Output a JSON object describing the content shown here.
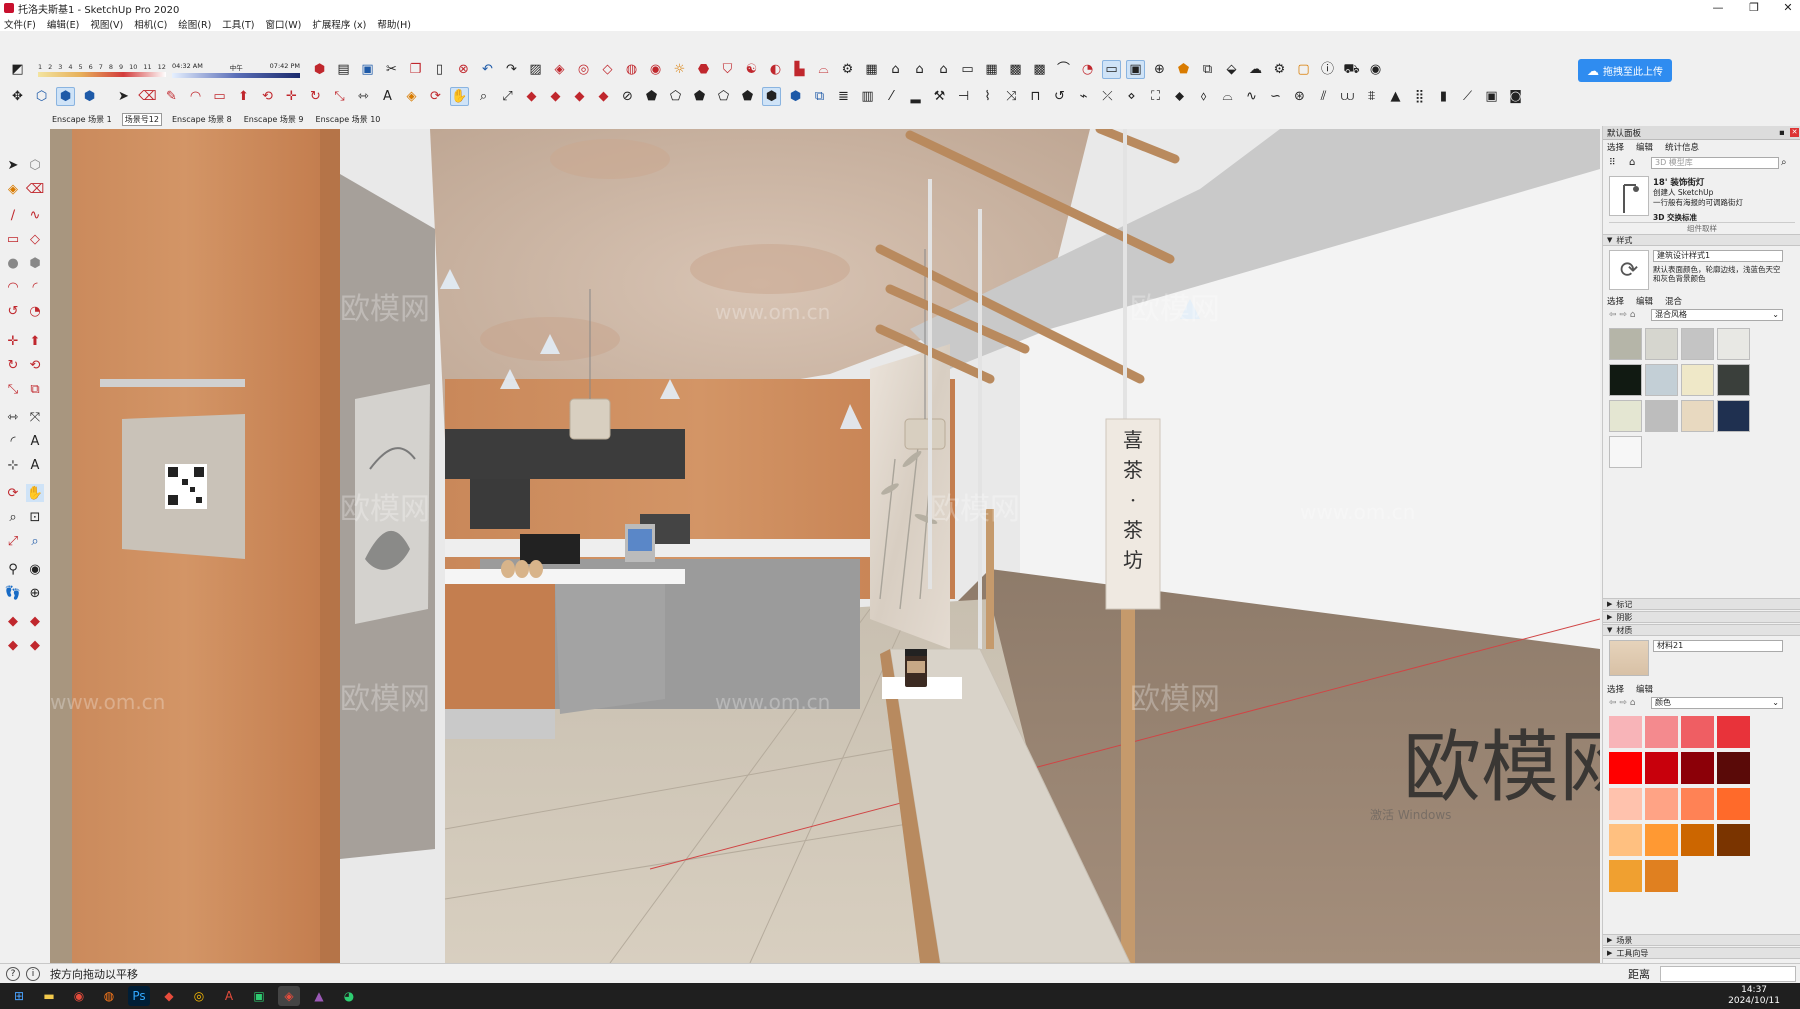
{
  "window": {
    "title": "托洛夫斯基1 - SketchUp Pro 2020",
    "minimize": "—",
    "restore": "❐",
    "close": "✕"
  },
  "menu": [
    "文件(F)",
    "编辑(E)",
    "视图(V)",
    "相机(C)",
    "绘图(R)",
    "工具(T)",
    "窗口(W)",
    "扩展程序 (x)",
    "帮助(H)"
  ],
  "shadow_settings": {
    "months": [
      "1",
      "2",
      "3",
      "4",
      "5",
      "6",
      "7",
      "8",
      "9",
      "10",
      "11",
      "12"
    ],
    "time_start": "04:32 AM",
    "time_mid": "中午",
    "time_end": "07:42 PM"
  },
  "upload_button": "拖拽至此上传",
  "scene_tabs": [
    {
      "label": "Enscape 场景 1",
      "active": false
    },
    {
      "label": "场景号12",
      "active": true
    },
    {
      "label": "Enscape 场景 8",
      "active": false
    },
    {
      "label": "Enscape 场景 9",
      "active": false
    },
    {
      "label": "Enscape 场景 10",
      "active": false
    }
  ],
  "viewport": {
    "sign_text": [
      "喜",
      "茶",
      "·",
      "茶",
      "坊"
    ],
    "watermarks": [
      "欧模网",
      "www.om.cn"
    ],
    "big_watermark": "欧模网",
    "ghost_text": "激活 Windows"
  },
  "panel": {
    "title": "默认面板",
    "components": {
      "tabs": [
        "选择",
        "编辑",
        "统计信息"
      ],
      "search_placeholder": "3D 模型库",
      "item_title": "18' 装饰街灯",
      "item_line1": "创建人 SketchUp",
      "item_line2": "一行般有海报的可调路街灯",
      "item_next": "3D 交换标准",
      "footer": "组件取样"
    },
    "styles": {
      "header": "样式",
      "style_name": "建筑设计样式1",
      "style_desc": "默认表面颜色，轮廓边线，浅蓝色天空和灰色背景颜色",
      "tabs": [
        "选择",
        "编辑",
        "混合"
      ],
      "dropdown": "混合风格"
    },
    "collapsed_sections": [
      "标记",
      "阴影"
    ],
    "materials": {
      "header": "材质",
      "name": "材料21",
      "tabs": [
        "选择",
        "编辑"
      ],
      "dropdown": "颜色"
    },
    "bottom_sections": [
      "场景",
      "工具向导"
    ]
  },
  "colors": {
    "swatches": [
      "#f8b4b8",
      "#f48a8e",
      "#ef5e63",
      "#e8333a",
      "#ff0000",
      "#c8000c",
      "#8c0008",
      "#5a0a08",
      "#ffc2ad",
      "#ffa385",
      "#ff8255",
      "#ff6a2a",
      "#ffc080",
      "#ff9933",
      "#cc6600",
      "#7a3400",
      "#f0a030",
      "#e08020"
    ]
  },
  "status": {
    "hint": "按方向拖动以平移",
    "distance_label": "距离"
  },
  "taskbar": {
    "time": "14:37",
    "date": "2024/10/11"
  }
}
